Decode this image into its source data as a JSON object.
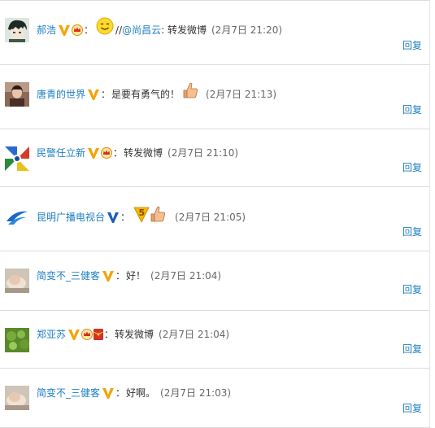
{
  "colors": {
    "link": "#1e7fc2",
    "text": "#333333",
    "divider": "#dcdcdc",
    "v_orange": "#f5a30a",
    "v_blue": "#1a5fb4"
  },
  "comments": [
    {
      "user": "郝浩",
      "badges": [
        "v-orange-icon",
        "crown-icon"
      ],
      "prefix": "",
      "emoji": "smile-emoji-icon",
      "mention_pre": "//",
      "mention": "@尚昌云",
      "text": ": 转发微博",
      "time": "(2月7日 21:20)",
      "reply": "回复"
    },
    {
      "user": "唐青的世界",
      "badges": [
        "v-orange-icon"
      ],
      "text": "是要有勇气的！",
      "emoji": "thumbs-up-emoji-icon",
      "time": "(2月7日 21:13)",
      "reply": "回复"
    },
    {
      "user": "民警任立新",
      "badges": [
        "v-orange-icon",
        "crown-icon"
      ],
      "text": "转发微博",
      "time": "(2月7日 21:10)",
      "reply": "回复"
    },
    {
      "user": "昆明广播电视台",
      "badges": [
        "v-blue-icon"
      ],
      "text": "",
      "emoji": "five-and-thumbs-up-emoji-icon",
      "time": "(2月7日 21:05)",
      "reply": "回复"
    },
    {
      "user": "简变不_三健客",
      "badges": [
        "v-orange-icon"
      ],
      "text": "好！",
      "time": "(2月7日 21:04)",
      "reply": "回复"
    },
    {
      "user": "郑亚苏",
      "badges": [
        "v-orange-icon",
        "crown-icon",
        "red-envelope-icon"
      ],
      "text": "转发微博",
      "time": "(2月7日 21:04)",
      "reply": "回复"
    },
    {
      "user": "简变不_三健客",
      "badges": [
        "v-orange-icon"
      ],
      "text": "好啊。",
      "time": "(2月7日 21:03)",
      "reply": "回复"
    }
  ]
}
